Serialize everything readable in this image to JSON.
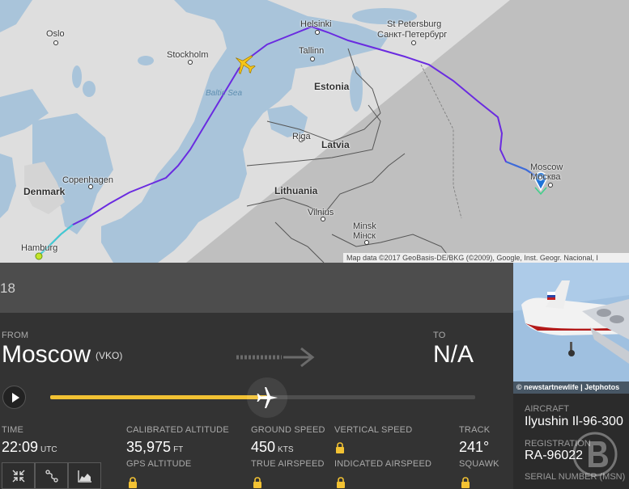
{
  "map": {
    "credit": "Map data ©2017 GeoBasis-DE/BKG (©2009), Google, Inst. Geogr. Nacional, I",
    "sea_label": "Baltic Sea",
    "countries": [
      "Estonia",
      "Latvia",
      "Lithuania",
      "Denmark"
    ],
    "cities": {
      "oslo": "Oslo",
      "stockholm": "Stockholm",
      "helsinki": "Helsinki",
      "st_petersburg": "St Petersburg",
      "st_petersburg_ru": "Санкт-Петербург",
      "tallinn": "Tallinn",
      "riga": "Riga",
      "copenhagen": "Copenhagen",
      "vilnius": "Vilnius",
      "minsk": "Minsk",
      "minsk_ru": "Мінск",
      "moscow": "Moscow",
      "moscow_ru": "Москва",
      "hamburg": "Hamburg"
    },
    "route_color": "#6a2be0",
    "plane_color": "#f5c518"
  },
  "header": {
    "flight_id": "18"
  },
  "flight": {
    "from_label": "FROM",
    "from_city": "Moscow",
    "from_code": "(VKO)",
    "to_label": "TO",
    "to_city": "N/A",
    "progress": 0.51
  },
  "stats": {
    "time_label": "TIME",
    "time_value": "22:09",
    "time_unit": "UTC",
    "cal_alt_label": "CALIBRATED ALTITUDE",
    "cal_alt_value": "35,975",
    "cal_alt_unit": "FT",
    "gps_alt_label": "GPS ALTITUDE",
    "ground_speed_label": "GROUND SPEED",
    "ground_speed_value": "450",
    "ground_speed_unit": "KTS",
    "true_airspeed_label": "TRUE AIRSPEED",
    "vertical_speed_label": "VERTICAL SPEED",
    "indicated_airspeed_label": "INDICATED AIRSPEED",
    "track_label": "TRACK",
    "track_value": "241°",
    "squawk_label": "SQUAWK"
  },
  "aircraft": {
    "photo_credit": "© newstartnewlife | Jetphotos",
    "aircraft_label": "AIRCRAFT",
    "aircraft_value": "Ilyushin Il-96-300",
    "registration_label": "REGISTRATION",
    "registration_value": "RA-96022",
    "serial_label": "SERIAL NUMBER (MSN)"
  },
  "toolbar": {
    "icons": [
      "collapse-icon",
      "route-icon",
      "chart-icon"
    ]
  },
  "colors": {
    "accent": "#f2c233",
    "panel": "#333333",
    "header": "#4d4d4d"
  }
}
